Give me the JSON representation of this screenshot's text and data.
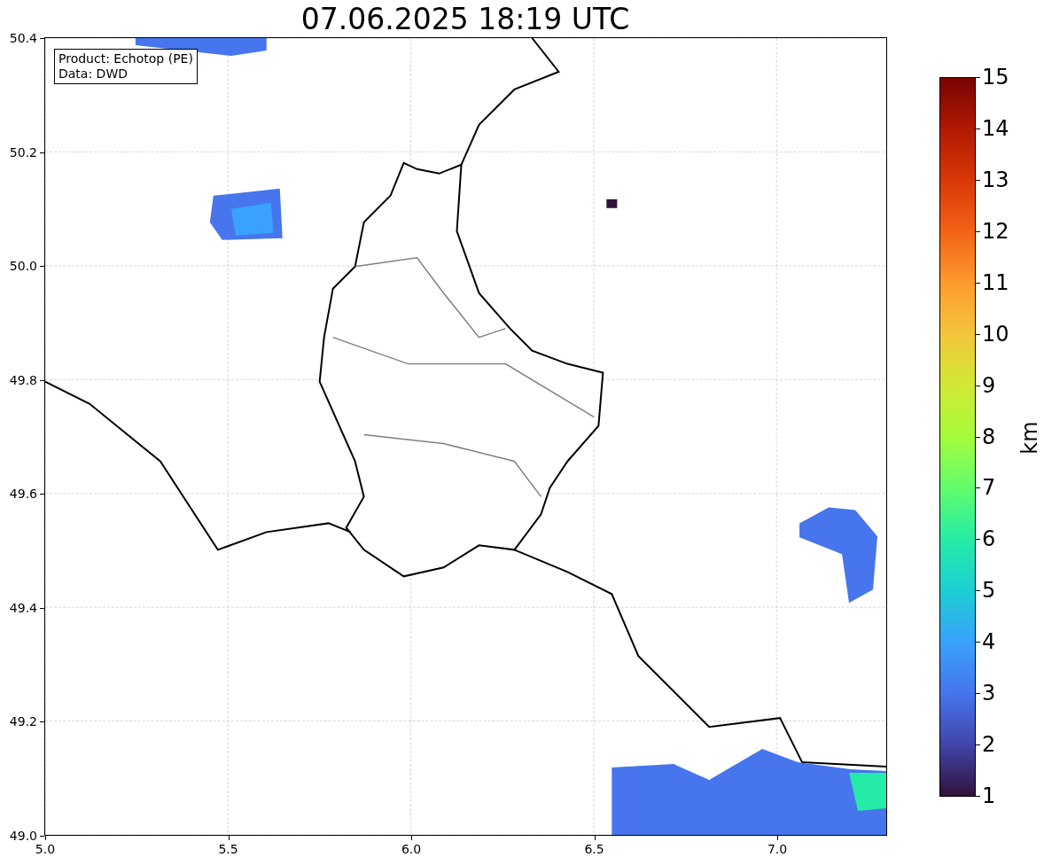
{
  "title": "07.06.2025 18:19 UTC",
  "info_box": [
    "Product: Echotop (PE)",
    "Data: DWD"
  ],
  "axes": {
    "xticks": [
      "5.0",
      "5.5",
      "6.0",
      "6.5",
      "7.0"
    ],
    "yticks": [
      "50.4",
      "50.2",
      "50.0",
      "49.8",
      "49.6",
      "49.4",
      "49.2",
      "49.0"
    ]
  },
  "colorbar": {
    "label": "km",
    "ticks": [
      "15",
      "14",
      "13",
      "12",
      "11",
      "10",
      "9",
      "8",
      "7",
      "6",
      "5",
      "4",
      "3",
      "2",
      "1"
    ]
  }
}
